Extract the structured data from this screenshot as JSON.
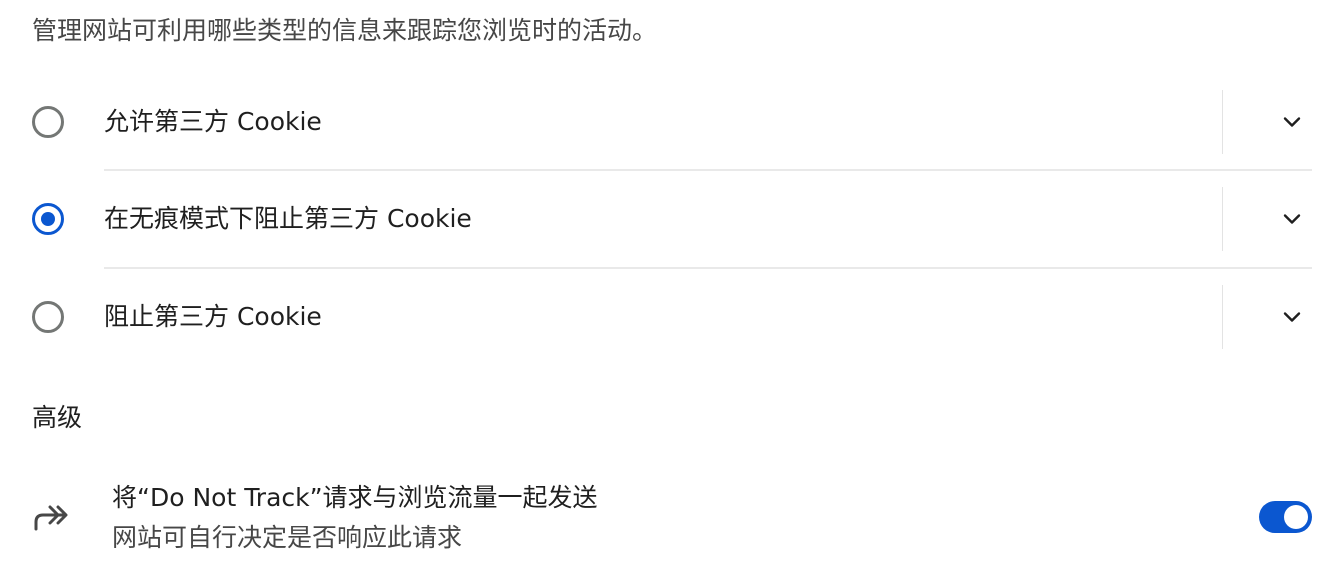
{
  "description": "管理网站可利用哪些类型的信息来跟踪您浏览时的活动。",
  "cookie_options": [
    {
      "label": "允许第三方 Cookie",
      "selected": false
    },
    {
      "label": "在无痕模式下阻止第三方 Cookie",
      "selected": true
    },
    {
      "label": "阻止第三方 Cookie",
      "selected": false
    }
  ],
  "advanced": {
    "title": "高级",
    "do_not_track": {
      "title": "将“Do Not Track”请求与浏览流量一起发送",
      "subtitle": "网站可自行决定是否响应此请求",
      "enabled": true,
      "icon": "redirect-arrows-icon"
    }
  },
  "colors": {
    "accent": "#0b57d0",
    "radio_border": "#747775",
    "separator": "#e3e3e3"
  }
}
